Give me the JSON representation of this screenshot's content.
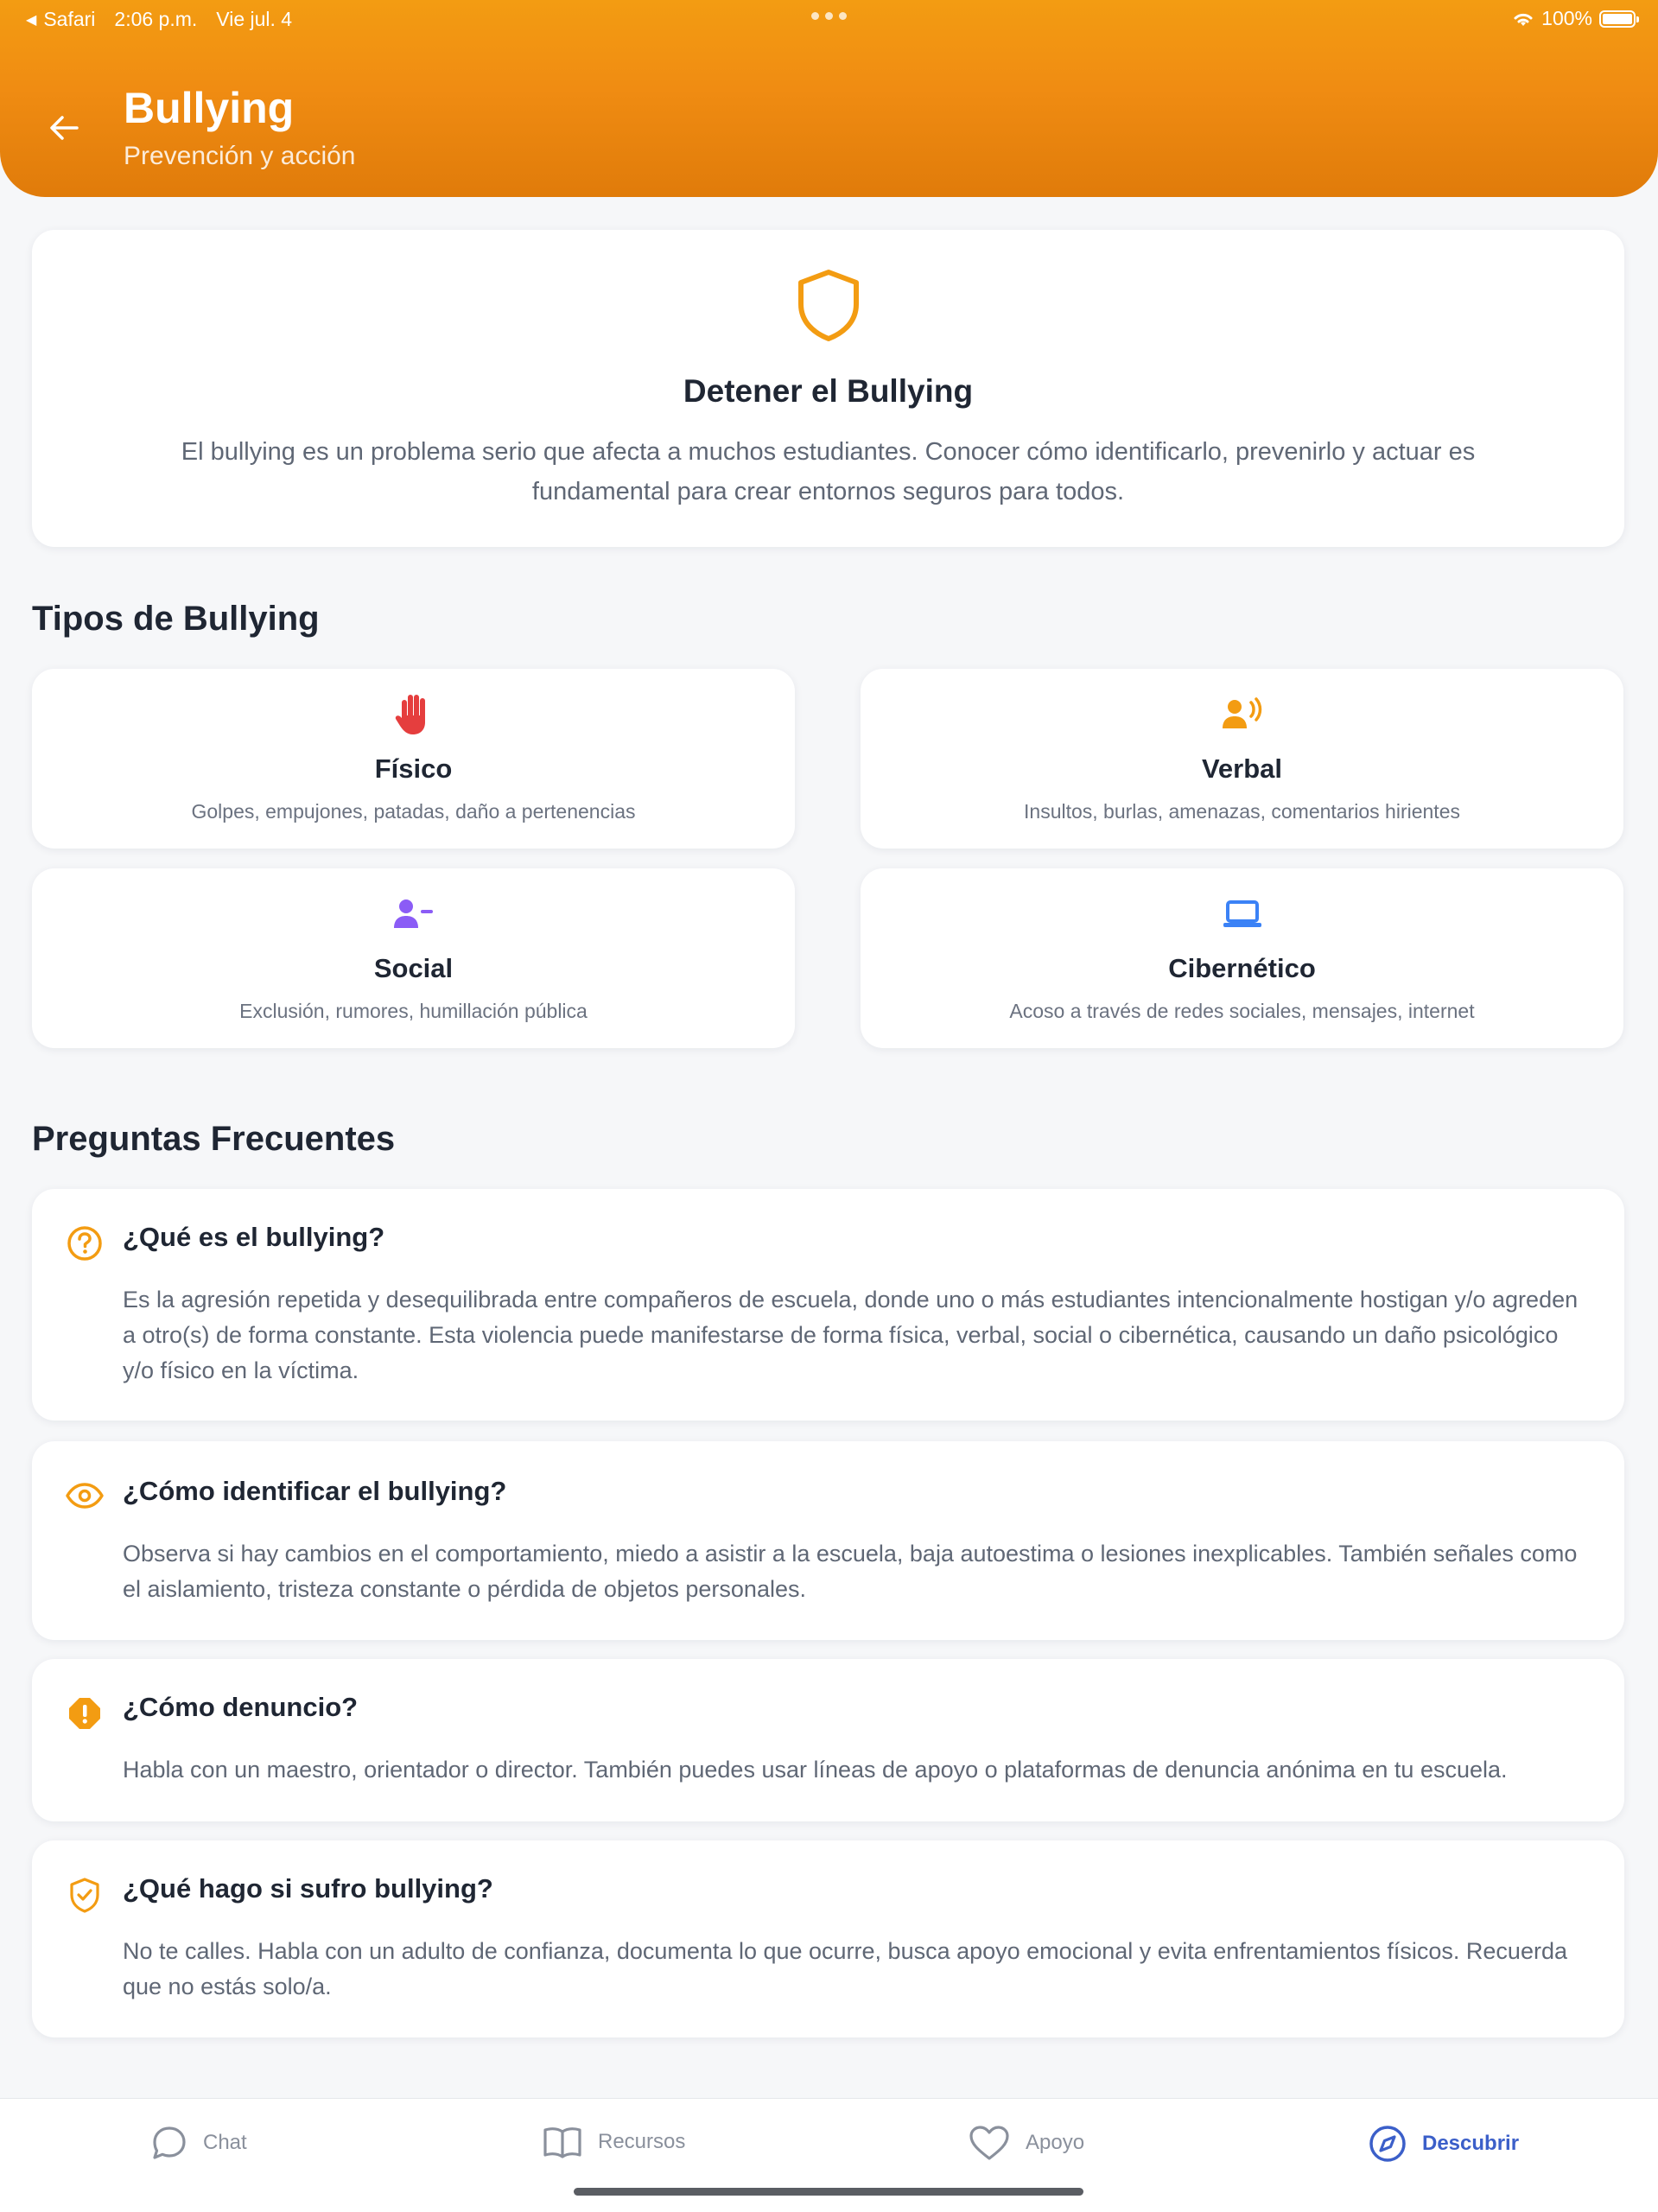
{
  "status_bar": {
    "app": "Safari",
    "time": "2:06 p.m.",
    "date": "Vie jul. 4",
    "battery": "100%"
  },
  "header": {
    "title": "Bullying",
    "subtitle": "Prevención y acción"
  },
  "hero": {
    "title": "Detener el Bullying",
    "text": "El bullying es un problema serio que afecta a muchos estudiantes. Conocer cómo identificarlo, prevenirlo y actuar es fundamental para crear entornos seguros para todos.",
    "icon": "shield-icon"
  },
  "types": {
    "title": "Tipos de Bullying",
    "items": [
      {
        "name": "Físico",
        "desc": "Golpes, empujones, patadas, daño a pertenencias",
        "icon": "hand-icon",
        "color": "#e53e3e"
      },
      {
        "name": "Verbal",
        "desc": "Insultos, burlas, amenazas, comentarios hirientes",
        "icon": "voice-icon",
        "color": "#f39c12"
      },
      {
        "name": "Social",
        "desc": "Exclusión, rumores, humillación pública",
        "icon": "user-minus-icon",
        "color": "#8b5cf6"
      },
      {
        "name": "Cibernético",
        "desc": "Acoso a través de redes sociales, mensajes, internet",
        "icon": "laptop-icon",
        "color": "#3b82f6"
      }
    ]
  },
  "faq": {
    "title": "Preguntas Frecuentes",
    "items": [
      {
        "q": "¿Qué es el bullying?",
        "a": "Es la agresión repetida y desequilibrada entre compañeros de escuela, donde uno o más estudiantes intencionalmente hostigan y/o agreden a otro(s) de forma constante. Esta violencia puede manifestarse de forma física, verbal, social o cibernética, causando un daño psicológico y/o físico en la víctima.",
        "icon": "question-circle-icon"
      },
      {
        "q": "¿Cómo identificar el bullying?",
        "a": "Observa si hay cambios en el comportamiento, miedo a asistir a la escuela, baja autoestima o lesiones inexplicables. También señales como el aislamiento, tristeza constante o pérdida de objetos personales.",
        "icon": "eye-icon"
      },
      {
        "q": "¿Cómo denuncio?",
        "a": "Habla con un maestro, orientador o director. También puedes usar líneas de apoyo o plataformas de denuncia anónima en tu escuela.",
        "icon": "alert-icon"
      },
      {
        "q": "¿Qué hago si sufro bullying?",
        "a": "No te calles. Habla con un adulto de confianza, documenta lo que ocurre, busca apoyo emocional y evita enfrentamientos físicos. Recuerda que no estás solo/a.",
        "icon": "shield-check-icon"
      }
    ]
  },
  "tabs": [
    {
      "label": "Chat",
      "icon": "chat-icon",
      "active": false
    },
    {
      "label": "Recursos",
      "icon": "book-icon",
      "active": false
    },
    {
      "label": "Apoyo",
      "icon": "heart-icon",
      "active": false
    },
    {
      "label": "Descubrir",
      "icon": "compass-icon",
      "active": true
    }
  ],
  "colors": {
    "accent": "#f39c12",
    "active_tab": "#3b5fc9"
  }
}
